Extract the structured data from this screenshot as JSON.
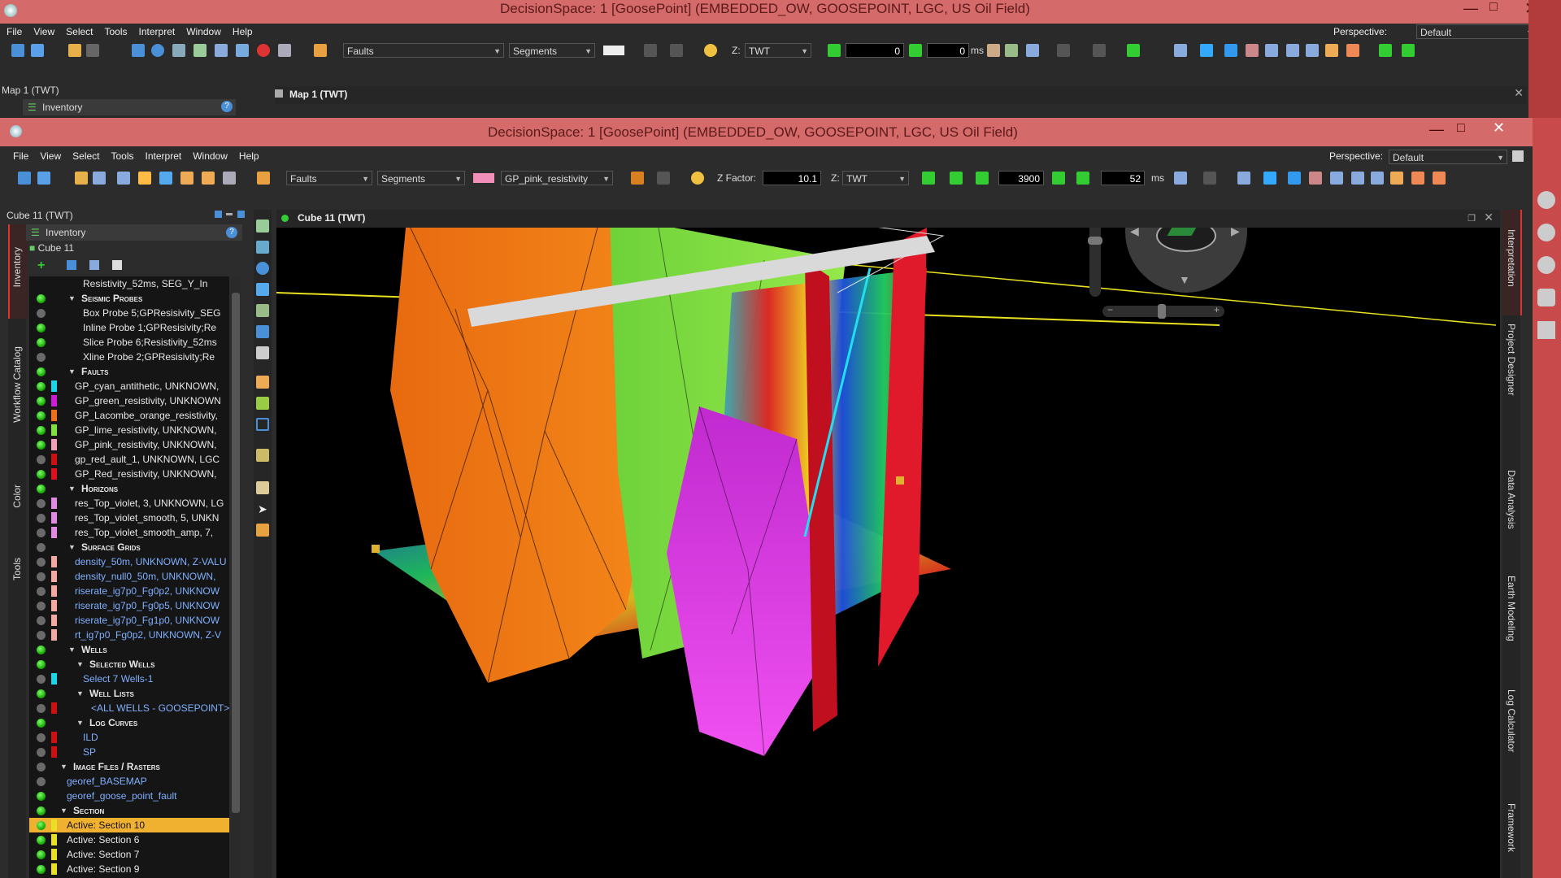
{
  "outer_window": {
    "title": "DecisionSpace: 1 [GoosePoint] (EMBEDDED_OW, GOOSEPOINT, LGC, US Oil Field)",
    "menu": [
      "File",
      "View",
      "Select",
      "Tools",
      "Interpret",
      "Window",
      "Help"
    ],
    "perspective_label": "Perspective:",
    "perspective_value": "Default",
    "object_combo": "Faults",
    "mode_combo": "Segments",
    "z_label": "Z:",
    "z_domain": "TWT",
    "time_value1": "0",
    "time_value2": "0",
    "time_unit": "ms",
    "map_panel_title": "Map 1 (TWT)",
    "inventory_label": "Inventory",
    "map_view_title": "Map 1 (TWT)"
  },
  "inner_window": {
    "title": "DecisionSpace: 1 [GoosePoint] (EMBEDDED_OW, GOOSEPOINT, LGC, US Oil Field)",
    "menu": [
      "File",
      "View",
      "Select",
      "Tools",
      "Interpret",
      "Window",
      "Help"
    ],
    "perspective_label": "Perspective:",
    "perspective_value": "Default",
    "object_combo": "Faults",
    "mode_combo": "Segments",
    "fault_combo": "GP_pink_resistivity",
    "zfactor_label": "Z Factor:",
    "zfactor_value": "10.1",
    "z_label": "Z:",
    "z_domain": "TWT",
    "frame_value": "3900",
    "step_value": "52",
    "time_unit": "ms",
    "panel_title": "Cube 11 (TWT)",
    "view_title": "Cube 11 (TWT)",
    "inventory_label": "Inventory",
    "root_label": "Cube 11",
    "left_tabs": [
      "Inventory",
      "Workflow Catalog",
      "Color",
      "Tools"
    ],
    "right_tabs": [
      "Interpretation",
      "Project Designer",
      "Data Analysis",
      "Earth Modeling",
      "Log Calculator",
      "Framework"
    ]
  },
  "inventory": [
    {
      "type": "item",
      "text": "Resistivity_52ms, SEG_Y_In",
      "state": "none",
      "color": "",
      "indent": 2
    },
    {
      "type": "header",
      "text": "Seismic Probes",
      "state": "on",
      "indent": 1
    },
    {
      "type": "item",
      "text": "Box Probe 5;GPResisivity_SEG",
      "state": "off",
      "color": "",
      "indent": 2
    },
    {
      "type": "item",
      "text": "Inline Probe 1;GPResisivity;Re",
      "state": "on",
      "color": "",
      "indent": 2
    },
    {
      "type": "item",
      "text": "Slice Probe 6;Resistivity_52ms",
      "state": "on",
      "color": "",
      "indent": 2
    },
    {
      "type": "item",
      "text": "Xline Probe 2;GPResisivity;Re",
      "state": "off",
      "color": "",
      "indent": 2
    },
    {
      "type": "header",
      "text": "Faults",
      "state": "on",
      "indent": 1
    },
    {
      "type": "item",
      "text": "GP_cyan_antithetic, UNKNOWN,",
      "state": "on",
      "color": "#19d6e8",
      "indent": 1
    },
    {
      "type": "item",
      "text": "GP_green_resistivity, UNKNOWN",
      "state": "on",
      "color": "#d21bd6",
      "indent": 1
    },
    {
      "type": "item",
      "text": "GP_Lacombe_orange_resistivity,",
      "state": "on",
      "color": "#f07018",
      "indent": 1
    },
    {
      "type": "item",
      "text": "GP_lime_resistivity, UNKNOWN,",
      "state": "on",
      "color": "#7ee23a",
      "indent": 1
    },
    {
      "type": "item",
      "text": "GP_pink_resistivity, UNKNOWN,",
      "state": "on",
      "color": "#f2a0b8",
      "indent": 1
    },
    {
      "type": "item",
      "text": "gp_red_ault_1, UNKNOWN, LGC",
      "state": "off",
      "color": "#d01010",
      "indent": 1
    },
    {
      "type": "item",
      "text": "GP_Red_resistivity, UNKNOWN,",
      "state": "on",
      "color": "#e00e1e",
      "indent": 1
    },
    {
      "type": "header",
      "text": "Horizons",
      "state": "on",
      "indent": 1
    },
    {
      "type": "item",
      "text": "res_Top_violet, 3, UNKNOWN, LG",
      "state": "off",
      "color": "#e28ae2",
      "indent": 1
    },
    {
      "type": "item",
      "text": "res_Top_violet_smooth, 5, UNKN",
      "state": "off",
      "color": "#e28ae2",
      "indent": 1
    },
    {
      "type": "item",
      "text": "res_Top_violet_smooth_amp, 7,",
      "state": "off",
      "color": "#e28ae2",
      "indent": 1
    },
    {
      "type": "header",
      "text": "Surface Grids",
      "state": "off",
      "indent": 1
    },
    {
      "type": "link",
      "text": "density_50m, UNKNOWN, Z-VALU",
      "state": "off",
      "color": "#f3a9a0",
      "indent": 1
    },
    {
      "type": "link",
      "text": "density_null0_50m, UNKNOWN,",
      "state": "off",
      "color": "#f3a9a0",
      "indent": 1
    },
    {
      "type": "link",
      "text": "riserate_ig7p0_Fg0p2, UNKNOW",
      "state": "off",
      "color": "#f3a9a0",
      "indent": 1
    },
    {
      "type": "link",
      "text": "riserate_ig7p0_Fg0p5, UNKNOW",
      "state": "off",
      "color": "#f3a9a0",
      "indent": 1
    },
    {
      "type": "link",
      "text": "riserate_ig7p0_Fg1p0, UNKNOW",
      "state": "off",
      "color": "#f3a9a0",
      "indent": 1
    },
    {
      "type": "link",
      "text": "rt_ig7p0_Fg0p2, UNKNOWN, Z-V",
      "state": "off",
      "color": "#f3a9a0",
      "indent": 1
    },
    {
      "type": "header",
      "text": "Wells",
      "state": "on",
      "indent": 1
    },
    {
      "type": "header",
      "text": "Selected Wells",
      "state": "on",
      "indent": 2
    },
    {
      "type": "link",
      "text": "Select 7 Wells-1",
      "state": "off",
      "color": "#19d6e8",
      "indent": 2
    },
    {
      "type": "header",
      "text": "Well Lists",
      "state": "on",
      "indent": 2
    },
    {
      "type": "link",
      "text": "<ALL WELLS - GOOSEPOINT>",
      "state": "off",
      "color": "#d01010",
      "indent": 3
    },
    {
      "type": "header",
      "text": "Log Curves",
      "state": "on",
      "indent": 2
    },
    {
      "type": "link",
      "text": "ILD",
      "state": "off",
      "color": "#d01010",
      "indent": 2
    },
    {
      "type": "link",
      "text": "SP",
      "state": "off",
      "color": "#d01010",
      "indent": 2
    },
    {
      "type": "header",
      "text": "Image Files / Rasters",
      "state": "off",
      "indent": 0
    },
    {
      "type": "link",
      "text": "georef_BASEMAP",
      "state": "off",
      "color": "",
      "indent": 0
    },
    {
      "type": "link",
      "text": "georef_goose_point_fault",
      "state": "on",
      "color": "",
      "indent": 0
    },
    {
      "type": "header",
      "text": "Section",
      "state": "on",
      "indent": 0
    },
    {
      "type": "selected",
      "text": "Active: Section 10",
      "state": "on",
      "color": "#e8e020",
      "indent": 0
    },
    {
      "type": "item",
      "text": "Active: Section 6",
      "state": "on",
      "color": "#e8e020",
      "indent": 0
    },
    {
      "type": "item",
      "text": "Active: Section 7",
      "state": "on",
      "color": "#e8e020",
      "indent": 0
    },
    {
      "type": "item",
      "text": "Active: Section 9",
      "state": "on",
      "color": "#e8e020",
      "indent": 0
    }
  ]
}
